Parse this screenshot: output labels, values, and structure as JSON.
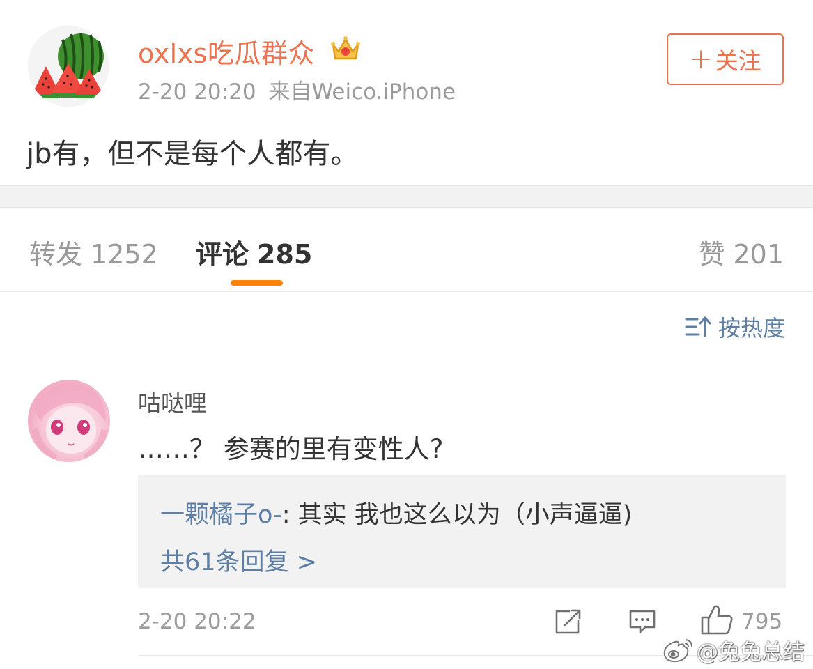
{
  "post": {
    "author": "oxlxs吃瓜群众",
    "time": "2-20 20:20",
    "source": "来自Weico.iPhone",
    "text": "jb有，但不是每个人都有。",
    "follow_label": "关注",
    "follow_plus": "+"
  },
  "tabs": {
    "repost_label": "转发",
    "repost_count": "1252",
    "comments_label": "评论",
    "comments_count": "285",
    "likes_label": "赞",
    "likes_count": "201"
  },
  "sort": {
    "label": "按热度"
  },
  "comment": {
    "user": "咕哒哩",
    "text": "……？ 参赛的里有变性人?",
    "reply": {
      "user": "一颗橘子o-",
      "separator": ": ",
      "text": "其实 我也这么以为（小声逼逼)",
      "more": "共61条回复 >"
    },
    "time": "2-20 20:22",
    "likes": "795"
  },
  "watermark": {
    "text": "@兔兔总结"
  },
  "colors": {
    "accent_orange": "#eb7350",
    "tab_indicator": "#ff8200",
    "link_blue": "#5d7fa5",
    "meta_gray": "#9b9b9b",
    "body_text": "#333333"
  },
  "icons": {
    "crown": "crown-icon",
    "sort": "sort-icon",
    "share": "share-icon",
    "comment": "comment-icon",
    "like": "thumbs-up-icon",
    "weibo": "weibo-logo-icon"
  }
}
